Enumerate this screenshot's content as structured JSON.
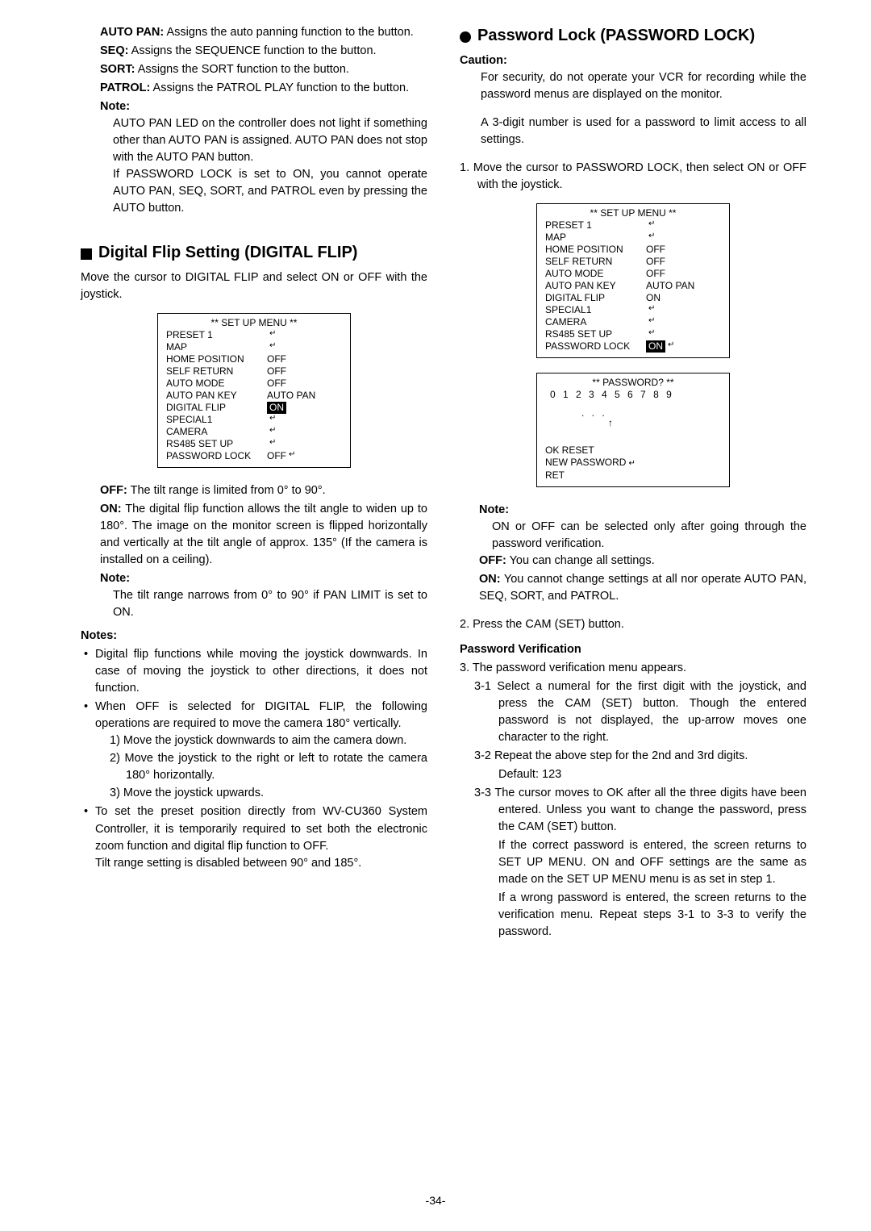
{
  "left": {
    "defs": [
      {
        "label": "AUTO PAN:",
        "text": " Assigns the auto panning function to the button."
      },
      {
        "label": "SEQ:",
        "text": " Assigns the SEQUENCE function to the button."
      },
      {
        "label": "SORT:",
        "text": " Assigns the SORT function to the button."
      },
      {
        "label": "PATROL:",
        "text": " Assigns the PATROL PLAY function to the button."
      }
    ],
    "note_h": "Note:",
    "note1": "AUTO PAN LED on the controller does not light if something other than AUTO PAN is assigned. AUTO PAN does not stop with the AUTO PAN button.",
    "note2": "If PASSWORD LOCK is set to ON, you cannot operate AUTO PAN, SEQ, SORT, and PATROL even by pressing the AUTO button.",
    "h2": "Digital Flip Setting (DIGITAL FLIP)",
    "para1": "Move the cursor to DIGITAL FLIP and select ON or OFF with the joystick.",
    "menu": {
      "title": "** SET UP MENU **",
      "rows": [
        {
          "k": "PRESET 1  ",
          "v": "",
          "arrow": true
        },
        {
          "k": "MAP ",
          "v": "",
          "arrow": true
        },
        {
          "k": "HOME POSITION",
          "v": "OFF"
        },
        {
          "k": "SELF RETURN",
          "v": "OFF"
        },
        {
          "k": "AUTO MODE",
          "v": "OFF"
        },
        {
          "k": "AUTO PAN KEY",
          "v": "AUTO PAN"
        },
        {
          "k": "DIGITAL FLIP",
          "v": "ON",
          "hl": true
        },
        {
          "k": "SPECIAL1  ",
          "v": "",
          "arrow": true
        },
        {
          "k": "CAMERA",
          "v": "",
          "arrow": true
        },
        {
          "k": "RS485 SET UP  ",
          "v": "",
          "arrow": true
        },
        {
          "k": "PASSWORD LOCK",
          "v": "OFF",
          "arrow": true
        }
      ]
    },
    "off_def": {
      "label": "OFF:",
      "text": " The tilt range is limited from 0° to 90°."
    },
    "on_def": {
      "label": "ON:",
      "text": " The digital flip function allows the tilt angle to widen up to 180°. The image on the monitor screen is flipped horizontally and vertically at the tilt angle of approx. 135° (If the camera is installed on a ceiling)."
    },
    "note_h2": "Note:",
    "note3": "The tilt range narrows from 0° to 90° if PAN LIMIT is set to ON.",
    "notes_h": "Notes:",
    "bullets": [
      "Digital flip functions while moving the joystick downwards. In case of moving the joystick to other directions, it does not function.",
      "When OFF is selected for DIGITAL FLIP, the following operations are required to move the camera 180° vertically."
    ],
    "sublist": [
      "1) Move the joystick downwards to aim the camera down.",
      "2) Move the joystick to the right or left to rotate the camera 180° horizontally.",
      "3) Move the joystick upwards."
    ],
    "bullet3a": "To set the preset position directly from WV-CU360 System Controller, it is temporarily required to set both the electronic zoom function and digital flip function to OFF.",
    "bullet3b": "Tilt range setting is disabled between 90° and 185°."
  },
  "right": {
    "h2": "Password Lock (PASSWORD LOCK)",
    "caution_h": "Caution:",
    "caution1": "For security, do not operate your VCR for recording while the password menus are displayed on the monitor.",
    "caution2": "A 3-digit number is used for a password to limit access to all settings.",
    "step1": "1. Move the cursor to PASSWORD LOCK, then select ON or OFF with the joystick.",
    "menu": {
      "title": "** SET UP MENU **",
      "rows": [
        {
          "k": "PRESET 1  ",
          "v": "",
          "arrow": true
        },
        {
          "k": "MAP ",
          "v": "",
          "arrow": true
        },
        {
          "k": "HOME POSITION",
          "v": "OFF"
        },
        {
          "k": "SELF RETURN",
          "v": "OFF"
        },
        {
          "k": "AUTO MODE",
          "v": "OFF"
        },
        {
          "k": "AUTO PAN KEY",
          "v": "AUTO PAN"
        },
        {
          "k": "DIGITAL FLIP",
          "v": "ON"
        },
        {
          "k": "SPECIAL1  ",
          "v": "",
          "arrow": true
        },
        {
          "k": "CAMERA",
          "v": "",
          "arrow": true
        },
        {
          "k": "RS485 SET UP  ",
          "v": "",
          "arrow": true
        },
        {
          "k": "PASSWORD LOCK",
          "v": "ON",
          "hl": true,
          "arrow": true
        }
      ]
    },
    "pw": {
      "title": "** PASSWORD? **",
      "digits": "0 1 2 3 4 5 6 7 8 9",
      "dots": ". . .",
      "up": "↑",
      "ok": "OK  RESET",
      "new": "NEW PASSWORD",
      "ret": "RET"
    },
    "note_h": "Note:",
    "note1": "ON or OFF can be selected only after going through the password verification.",
    "off_def": {
      "label": "OFF:",
      "text": " You can change all settings."
    },
    "on_def": {
      "label": "ON:",
      "text": " You cannot change settings at all nor operate AUTO PAN, SEQ, SORT, and PATROL."
    },
    "step2": "2. Press the CAM (SET) button.",
    "subhead": "Password Verification",
    "step3": "3. The password verification menu appears.",
    "s31": "3-1 Select a numeral for the first digit with the joystick, and press the CAM (SET) button. Though the entered password is not displayed, the up-arrow moves one character to the right.",
    "s32": "3-2 Repeat the above step for the 2nd and 3rd digits.",
    "s32b": "Default: 123",
    "s33a": "3-3 The cursor moves to OK after all the three digits have been entered. Unless you want to change the password, press the CAM (SET) button.",
    "s33b": "If the correct password is entered, the screen returns to SET UP MENU. ON and OFF settings are the same as made on the SET UP MENU menu is as set in step 1.",
    "s33c": "If a wrong password is entered, the screen returns to the verification menu. Repeat steps 3-1 to 3-3 to verify the password."
  },
  "page_num": "-34-"
}
